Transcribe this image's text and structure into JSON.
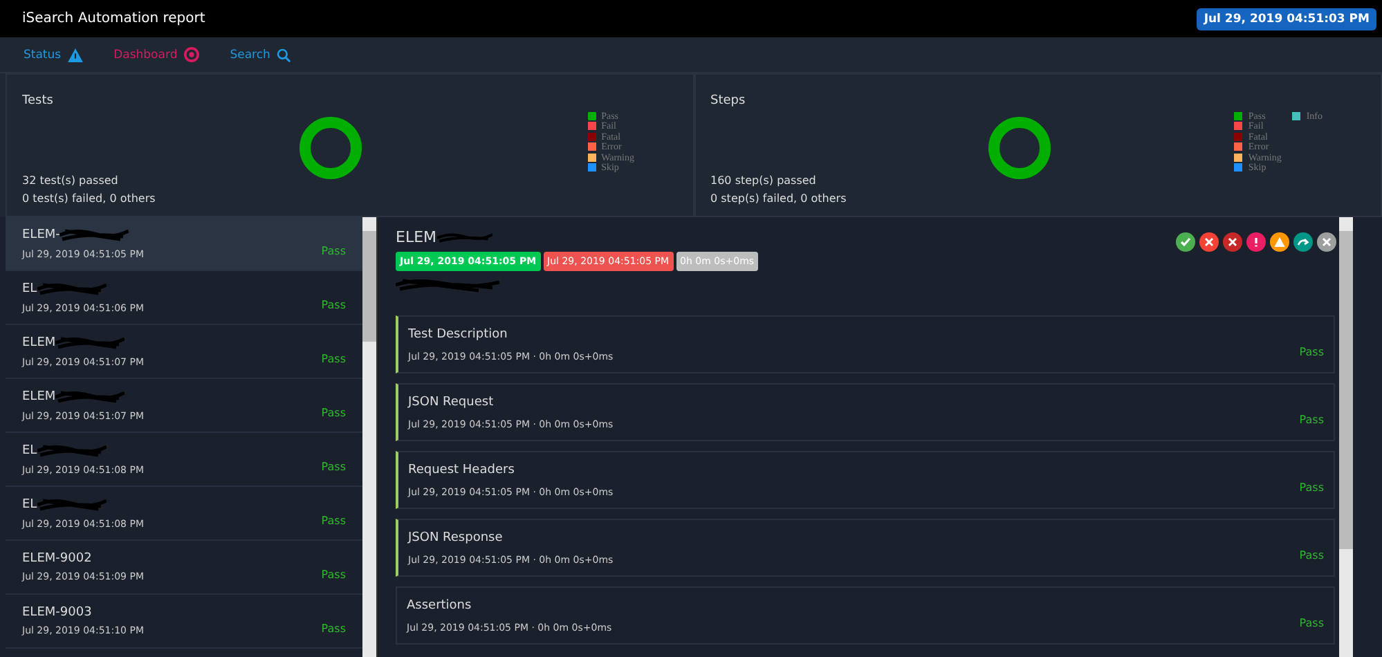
{
  "header": {
    "title": "iSearch Automation report",
    "timestamp": "Jul 29, 2019 04:51:03 PM"
  },
  "nav": [
    {
      "label": "Status",
      "kind": "warning",
      "color": "#1e9be0"
    },
    {
      "label": "Dashboard",
      "kind": "target",
      "color": "#d81b60"
    },
    {
      "label": "Search",
      "kind": "search",
      "color": "#1e9be0"
    }
  ],
  "panels": [
    {
      "title": "Tests",
      "passed": "32 test(s) passed",
      "failed": "0 test(s) failed, 0 others",
      "legend": [
        {
          "label": "Pass",
          "color": "#00af00"
        },
        {
          "label": "Fail",
          "color": "#f7464a"
        },
        {
          "label": "Fatal",
          "color": "#8b0000"
        },
        {
          "label": "Error",
          "color": "#ff6347"
        },
        {
          "label": "Warning",
          "color": "#fdb45c"
        },
        {
          "label": "Skip",
          "color": "#1e90ff"
        }
      ]
    },
    {
      "title": "Steps",
      "passed": "160 step(s) passed",
      "failed": "0 step(s) failed, 0 others",
      "legend": [
        {
          "label": "Pass",
          "color": "#00af00"
        },
        {
          "label": "Fail",
          "color": "#f7464a"
        },
        {
          "label": "Fatal",
          "color": "#8b0000"
        },
        {
          "label": "Error",
          "color": "#ff6347"
        },
        {
          "label": "Warning",
          "color": "#fdb45c"
        },
        {
          "label": "Skip",
          "color": "#1e90ff"
        }
      ],
      "legend_extra": [
        {
          "label": "Info",
          "color": "#46bfbd"
        }
      ]
    }
  ],
  "tests": [
    {
      "name": "ELEM-",
      "redacted": true,
      "time": "Jul 29, 2019 04:51:05 PM",
      "status": "Pass",
      "selected": true
    },
    {
      "name": "EL",
      "redacted": true,
      "time": "Jul 29, 2019 04:51:06 PM",
      "status": "Pass",
      "selected": false
    },
    {
      "name": "ELEM",
      "redacted": true,
      "time": "Jul 29, 2019 04:51:07 PM",
      "status": "Pass",
      "selected": false
    },
    {
      "name": "ELEM",
      "redacted": true,
      "time": "Jul 29, 2019 04:51:07 PM",
      "status": "Pass",
      "selected": false
    },
    {
      "name": "EL",
      "redacted": true,
      "time": "Jul 29, 2019 04:51:08 PM",
      "status": "Pass",
      "selected": false
    },
    {
      "name": "EL",
      "redacted": true,
      "time": "Jul 29, 2019 04:51:08 PM",
      "status": "Pass",
      "selected": false
    },
    {
      "name": "ELEM-9002",
      "redacted": false,
      "time": "Jul 29, 2019 04:51:09 PM",
      "status": "Pass",
      "selected": false
    },
    {
      "name": "ELEM-9003",
      "redacted": false,
      "time": "Jul 29, 2019 04:51:10 PM",
      "status": "Pass",
      "selected": false
    }
  ],
  "detail": {
    "title": "ELEM",
    "start": "Jul 29, 2019 04:51:05 PM",
    "end": "Jul 29, 2019 04:51:05 PM",
    "duration": "0h 0m 0s+0ms",
    "filters": [
      {
        "kind": "check",
        "color": "#4caf50"
      },
      {
        "kind": "cross",
        "color": "#f44336"
      },
      {
        "kind": "cross",
        "color": "#c62828"
      },
      {
        "kind": "exclaim",
        "color": "#e91e63"
      },
      {
        "kind": "warning",
        "color": "#ff9800"
      },
      {
        "kind": "skip",
        "color": "#009688"
      },
      {
        "kind": "close",
        "color": "#9e9e9e"
      }
    ],
    "steps": [
      {
        "title": "Test Description",
        "meta": "Jul 29, 2019 04:51:05 PM · 0h 0m 0s+0ms",
        "status": "Pass",
        "marked": true
      },
      {
        "title": "JSON Request",
        "meta": "Jul 29, 2019 04:51:05 PM · 0h 0m 0s+0ms",
        "status": "Pass",
        "marked": true
      },
      {
        "title": "Request Headers",
        "meta": "Jul 29, 2019 04:51:05 PM · 0h 0m 0s+0ms",
        "status": "Pass",
        "marked": true
      },
      {
        "title": "JSON Response",
        "meta": "Jul 29, 2019 04:51:05 PM · 0h 0m 0s+0ms",
        "status": "Pass",
        "marked": true
      },
      {
        "title": "Assertions",
        "meta": "Jul 29, 2019 04:51:05 PM · 0h 0m 0s+0ms",
        "status": "Pass",
        "marked": false
      }
    ]
  }
}
